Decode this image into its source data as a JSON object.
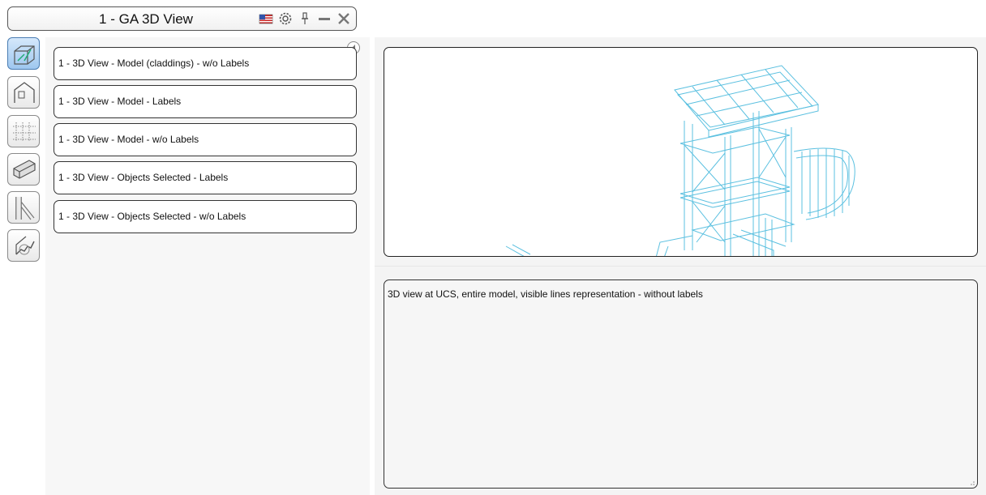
{
  "window": {
    "title": "1 - GA 3D View",
    "icons": [
      "flag-icon",
      "gear-icon",
      "pin-icon",
      "minimize-icon",
      "close-icon"
    ]
  },
  "toolbar": {
    "buttons": [
      {
        "name": "3d-view",
        "active": true
      },
      {
        "name": "elevation-view",
        "active": false
      },
      {
        "name": "grid-view",
        "active": false
      },
      {
        "name": "section-view",
        "active": false
      },
      {
        "name": "detail-view",
        "active": false
      },
      {
        "name": "stair-view",
        "active": false
      }
    ]
  },
  "views": {
    "items": [
      {
        "label": "1 - 3D View - Model (claddings) - w/o Labels"
      },
      {
        "label": "1 - 3D View - Model - Labels"
      },
      {
        "label": "1 - 3D View - Model - w/o Labels"
      },
      {
        "label": "1 - 3D View - Objects Selected - Labels"
      },
      {
        "label": "1 - 3D View - Objects Selected - w/o Labels"
      }
    ]
  },
  "description": {
    "text": "3D view at UCS, entire model, visible lines representation - without labels"
  },
  "colors": {
    "model_lines": "#5bc0e0",
    "active_button": "#9ec7ef",
    "flag_red": "#cc2b2b",
    "flag_blue": "#3355aa"
  }
}
